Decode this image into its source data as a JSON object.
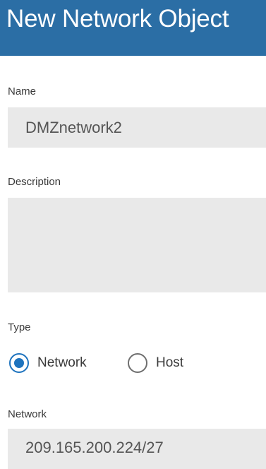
{
  "dialog": {
    "title": "New Network Object"
  },
  "form": {
    "name": {
      "label": "Name",
      "value": "DMZnetwork2"
    },
    "description": {
      "label": "Description",
      "value": ""
    },
    "type": {
      "label": "Type",
      "options": [
        {
          "label": "Network",
          "selected": true
        },
        {
          "label": "Host",
          "selected": false
        }
      ]
    },
    "network": {
      "label": "Network",
      "value": "209.165.200.224/27"
    }
  },
  "colors": {
    "header_bg": "#2b6ea5",
    "field_bg": "#e9e9e9",
    "radio_accent": "#1e73be"
  }
}
